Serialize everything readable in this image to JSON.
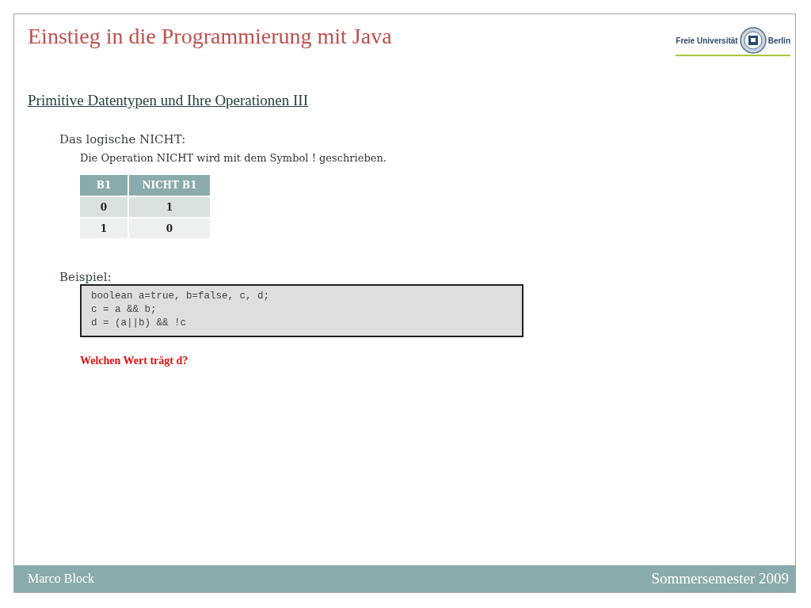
{
  "slide": {
    "title": "Einstieg in die Programmierung mit Java",
    "logo": {
      "left": "Freie Universität",
      "right": "Berlin"
    },
    "subtitle": "Primitive Datentypen und Ihre Operationen III",
    "sections": [
      {
        "kind": "heading",
        "text": "Das logische NICHT:"
      },
      {
        "kind": "text",
        "text": "Die Operation NICHT wird mit dem Symbol !  geschrieben."
      },
      {
        "kind": "table",
        "columns": [
          "B1",
          "NICHT B1"
        ],
        "rows": [
          [
            "0",
            "1"
          ],
          [
            "1",
            "0"
          ]
        ]
      },
      {
        "kind": "heading",
        "text": "Beispiel:"
      },
      {
        "kind": "code",
        "lines": [
          "boolean a=true, b=false, c, d;",
          "c = a && b;",
          "d = (a||b) && !c"
        ]
      },
      {
        "kind": "question",
        "text": "Welchen Wert trägt d?"
      }
    ],
    "footer": {
      "author": "Marco Block",
      "term": "Sommersemester 2009"
    }
  }
}
